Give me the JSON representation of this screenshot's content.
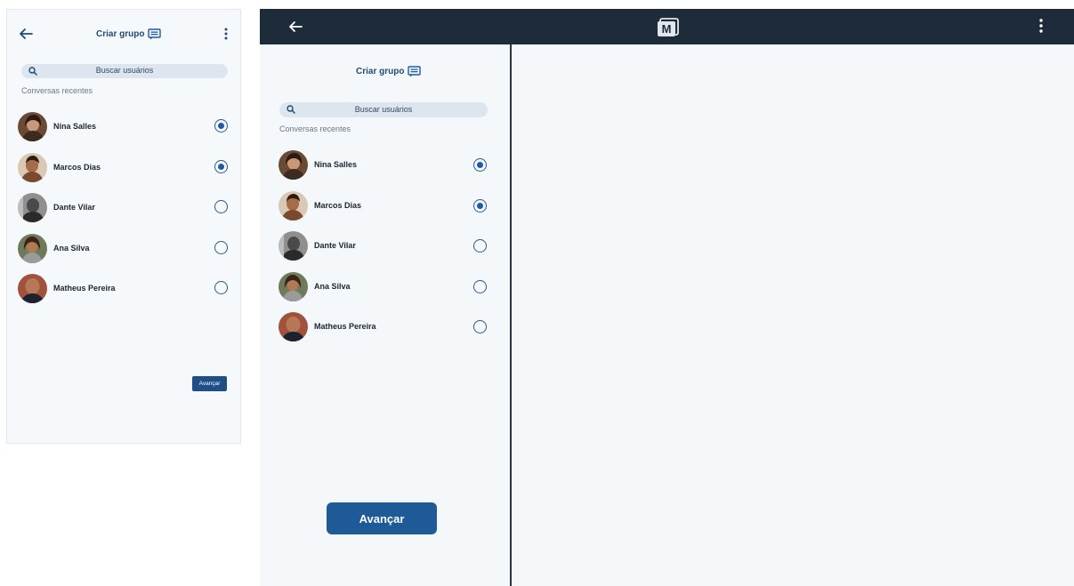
{
  "mobile": {
    "title": "Criar grupo",
    "search_placeholder": "Buscar usuários",
    "recent_label": "Conversas recentes",
    "contacts": [
      {
        "name": "Nina Salles",
        "selected": true
      },
      {
        "name": "Marcos Dias",
        "selected": true
      },
      {
        "name": "Dante Vilar",
        "selected": false
      },
      {
        "name": "Ana Silva",
        "selected": false
      },
      {
        "name": "Matheus Pereira",
        "selected": false
      }
    ],
    "advance_label": "Avançar"
  },
  "desktop": {
    "logo_letter": "M",
    "title": "Criar grupo",
    "search_placeholder": "Buscar usuários",
    "recent_label": "Conversas recentes",
    "contacts": [
      {
        "name": "Nina Salles",
        "selected": true
      },
      {
        "name": "Marcos Dias",
        "selected": true
      },
      {
        "name": "Dante Vilar",
        "selected": false
      },
      {
        "name": "Ana Silva",
        "selected": false
      },
      {
        "name": "Matheus Pereira",
        "selected": false
      }
    ],
    "advance_label": "Avançar"
  },
  "colors": {
    "brand": "#1f4a79",
    "accent": "#1f5aa6",
    "topbar": "#1e2b3a"
  },
  "icons": [
    "back-arrow-icon",
    "chat-group-icon",
    "more-vert-icon",
    "search-icon",
    "app-logo-icon"
  ]
}
